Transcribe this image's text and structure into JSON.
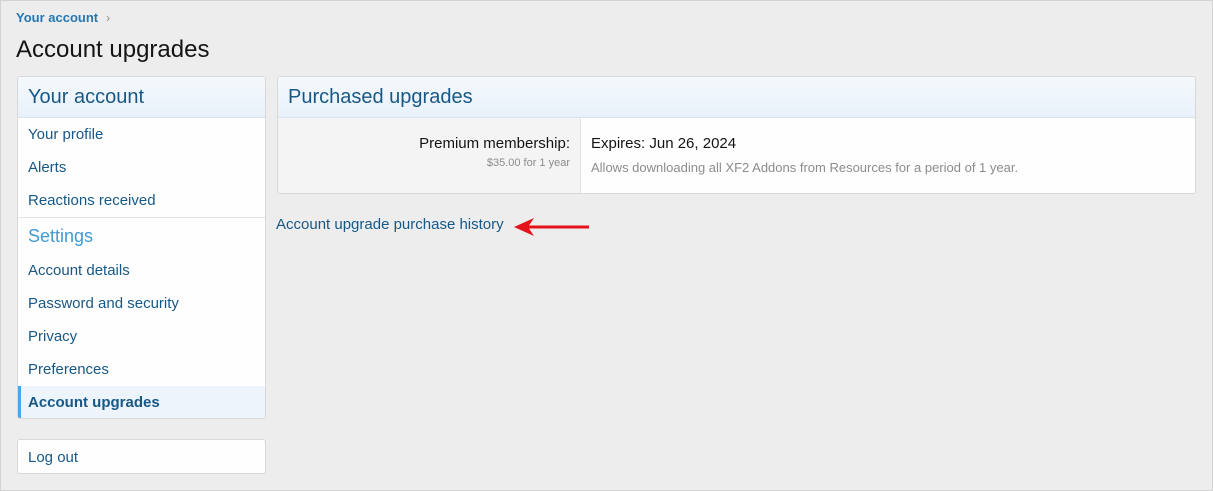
{
  "breadcrumb": {
    "label": "Your account"
  },
  "page": {
    "title": "Account upgrades"
  },
  "sidebar": {
    "heading": "Your account",
    "items": [
      {
        "label": "Your profile"
      },
      {
        "label": "Alerts"
      },
      {
        "label": "Reactions received"
      }
    ],
    "settings_heading": "Settings",
    "settings_items": [
      {
        "label": "Account details"
      },
      {
        "label": "Password and security"
      },
      {
        "label": "Privacy"
      },
      {
        "label": "Preferences"
      },
      {
        "label": "Account upgrades",
        "active": true
      }
    ],
    "logout_label": "Log out"
  },
  "purchased": {
    "heading": "Purchased upgrades",
    "upgrade_name": "Premium membership:",
    "upgrade_price": "$35.00 for 1 year",
    "expires": "Expires: Jun 26, 2024",
    "description": "Allows downloading all XF2 Addons from Resources for a period of 1 year."
  },
  "history_link": "Account upgrade purchase history",
  "colors": {
    "link": "#185886",
    "accent": "#47a7eb",
    "arrow": "#e3121b"
  },
  "icons": {
    "breadcrumb_separator": "chevron-right-icon",
    "annotation": "red-arrow-left-icon"
  }
}
